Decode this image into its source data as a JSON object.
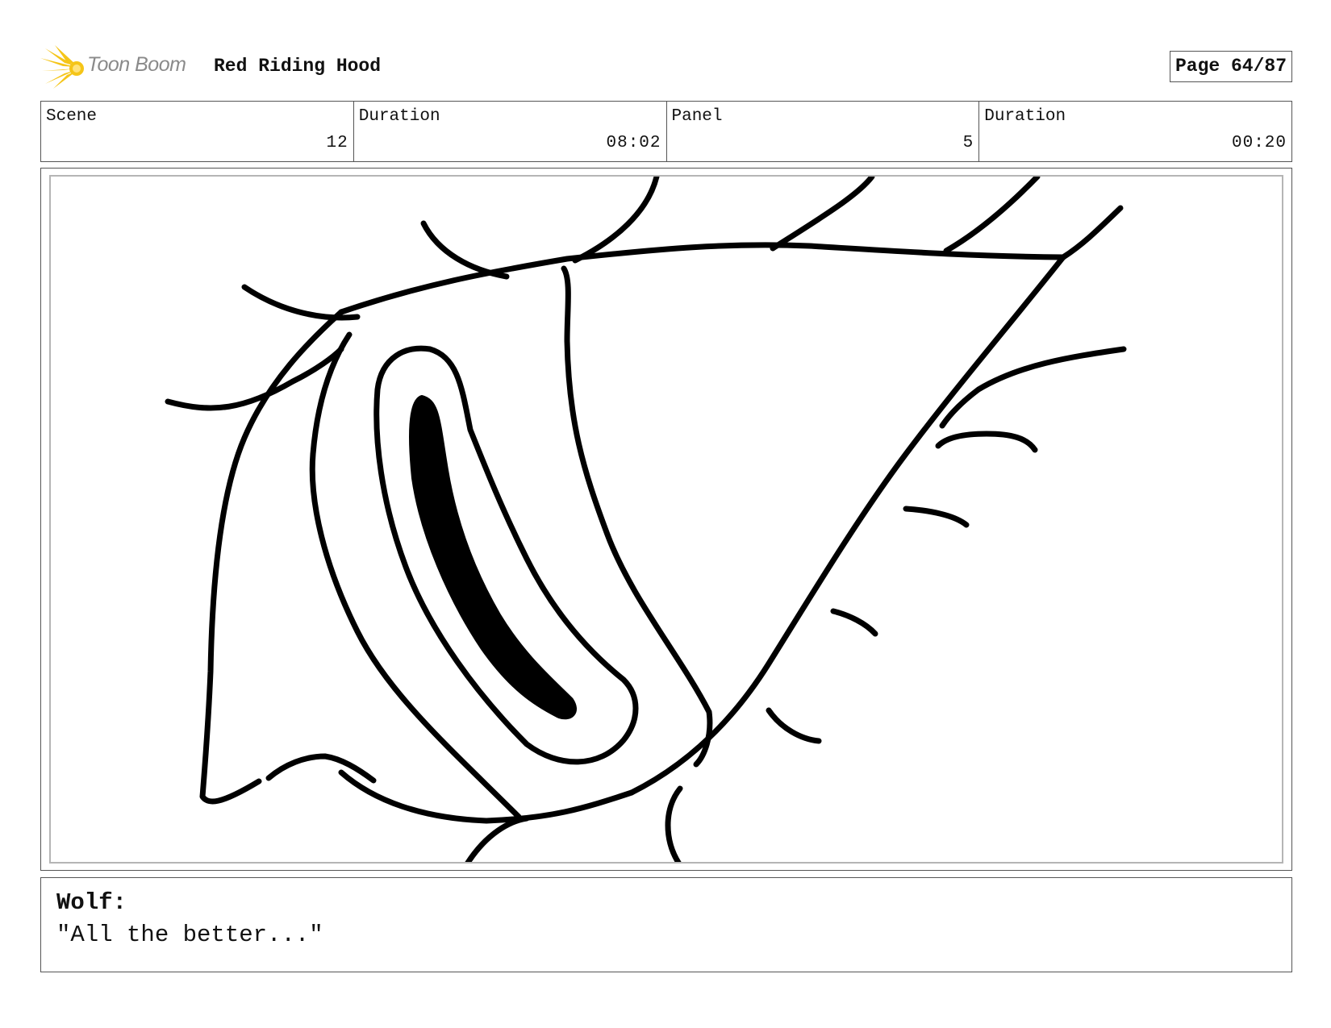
{
  "header": {
    "logo_text": "Toon Boom",
    "project_title": "Red Riding Hood",
    "page_label": "Page 64/87"
  },
  "info": {
    "scene_label": "Scene",
    "scene_value": "12",
    "scene_duration_label": "Duration",
    "scene_duration_value": "08:02",
    "panel_label": "Panel",
    "panel_value": "5",
    "panel_duration_label": "Duration",
    "panel_duration_value": "00:20"
  },
  "dialogue": {
    "speaker": "Wolf:",
    "line": "\"All the better...\""
  },
  "icons": {
    "logo": "toon-boom-burst-icon"
  },
  "colors": {
    "logo_burst": "#f5c518",
    "logo_text": "#8a8a8a",
    "border": "#555555",
    "panel_inner_border": "#b5b5b5"
  }
}
